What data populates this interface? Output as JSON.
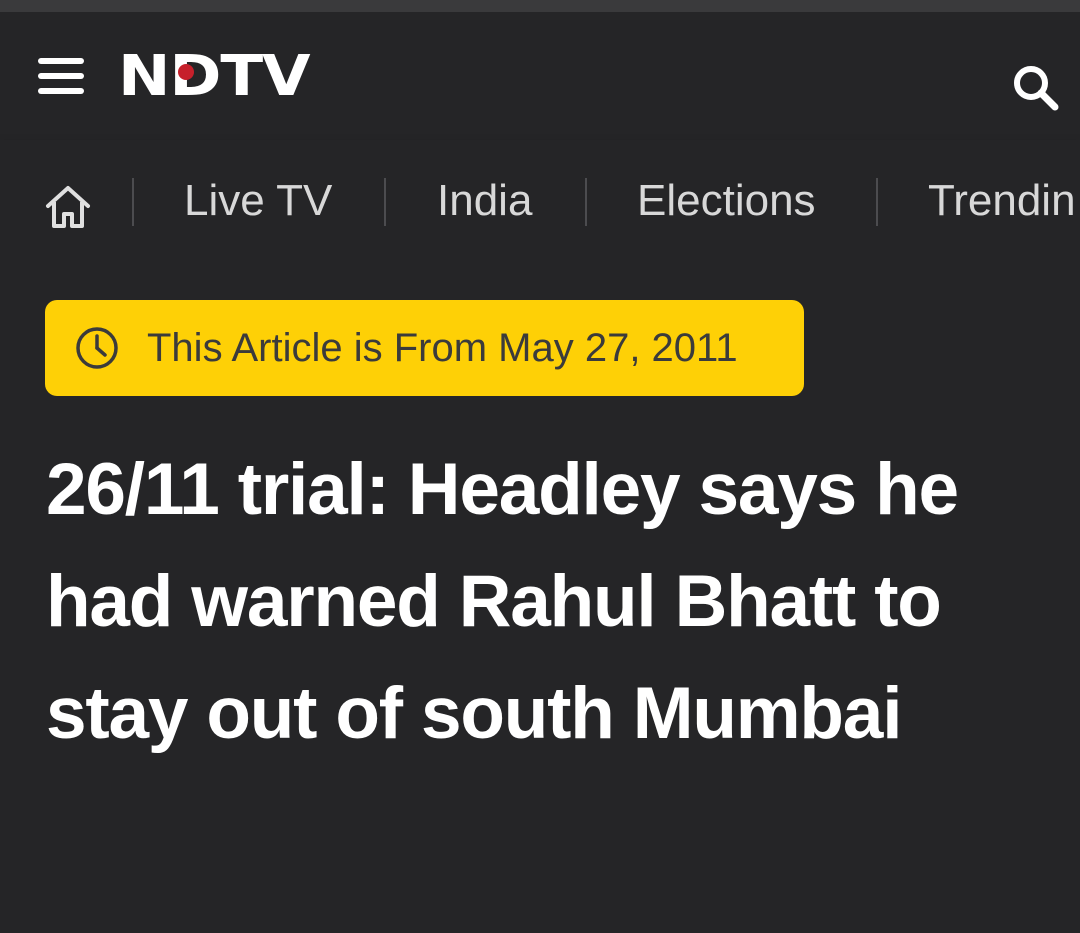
{
  "header": {
    "brand": "NDTV",
    "menu_icon": "hamburger-menu-icon",
    "search_icon": "search-icon",
    "brand_accent_color": "#c6202b"
  },
  "nav": {
    "home_icon": "home-icon",
    "items": [
      {
        "label": "Live TV"
      },
      {
        "label": "India"
      },
      {
        "label": "Elections"
      },
      {
        "label": "Trendin"
      }
    ]
  },
  "article": {
    "date_notice": "This Article is From May 27, 2011",
    "date_icon": "clock-icon",
    "badge_color": "#fed006",
    "headline": "26/11 trial: Headley says he had warned Rahul Bhatt to stay out of south Mumbai"
  }
}
